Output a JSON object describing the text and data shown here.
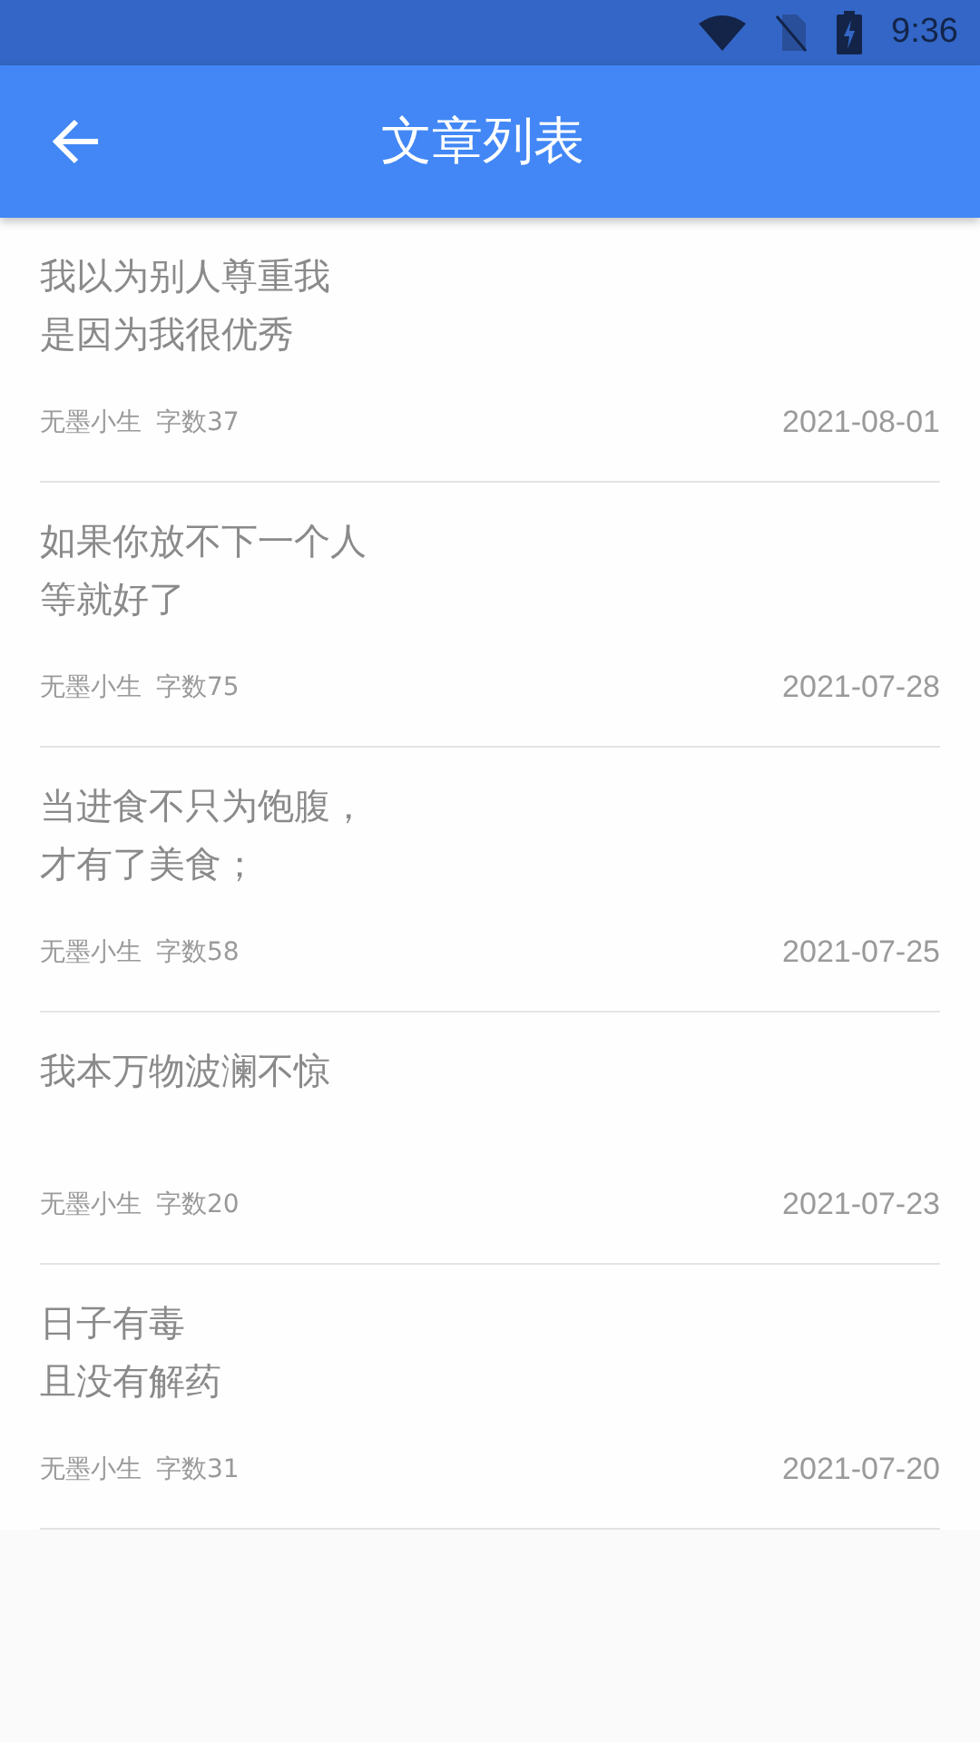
{
  "status_bar": {
    "time": "9:36"
  },
  "app_bar": {
    "title": "文章列表"
  },
  "articles": [
    {
      "lines": [
        "我以为别人尊重我",
        "是因为我很优秀"
      ],
      "author": "无墨小生",
      "word_count": "字数37",
      "date": "2021-08-01"
    },
    {
      "lines": [
        "如果你放不下一个人",
        "等就好了"
      ],
      "author": "无墨小生",
      "word_count": "字数75",
      "date": "2021-07-28"
    },
    {
      "lines": [
        "当进食不只为饱腹，",
        "才有了美食；"
      ],
      "author": "无墨小生",
      "word_count": "字数58",
      "date": "2021-07-25"
    },
    {
      "lines": [
        "我本万物波澜不惊"
      ],
      "author": "无墨小生",
      "word_count": "字数20",
      "date": "2021-07-23"
    },
    {
      "lines": [
        "日子有毒",
        "且没有解药"
      ],
      "author": "无墨小生",
      "word_count": "字数31",
      "date": "2021-07-20"
    }
  ]
}
